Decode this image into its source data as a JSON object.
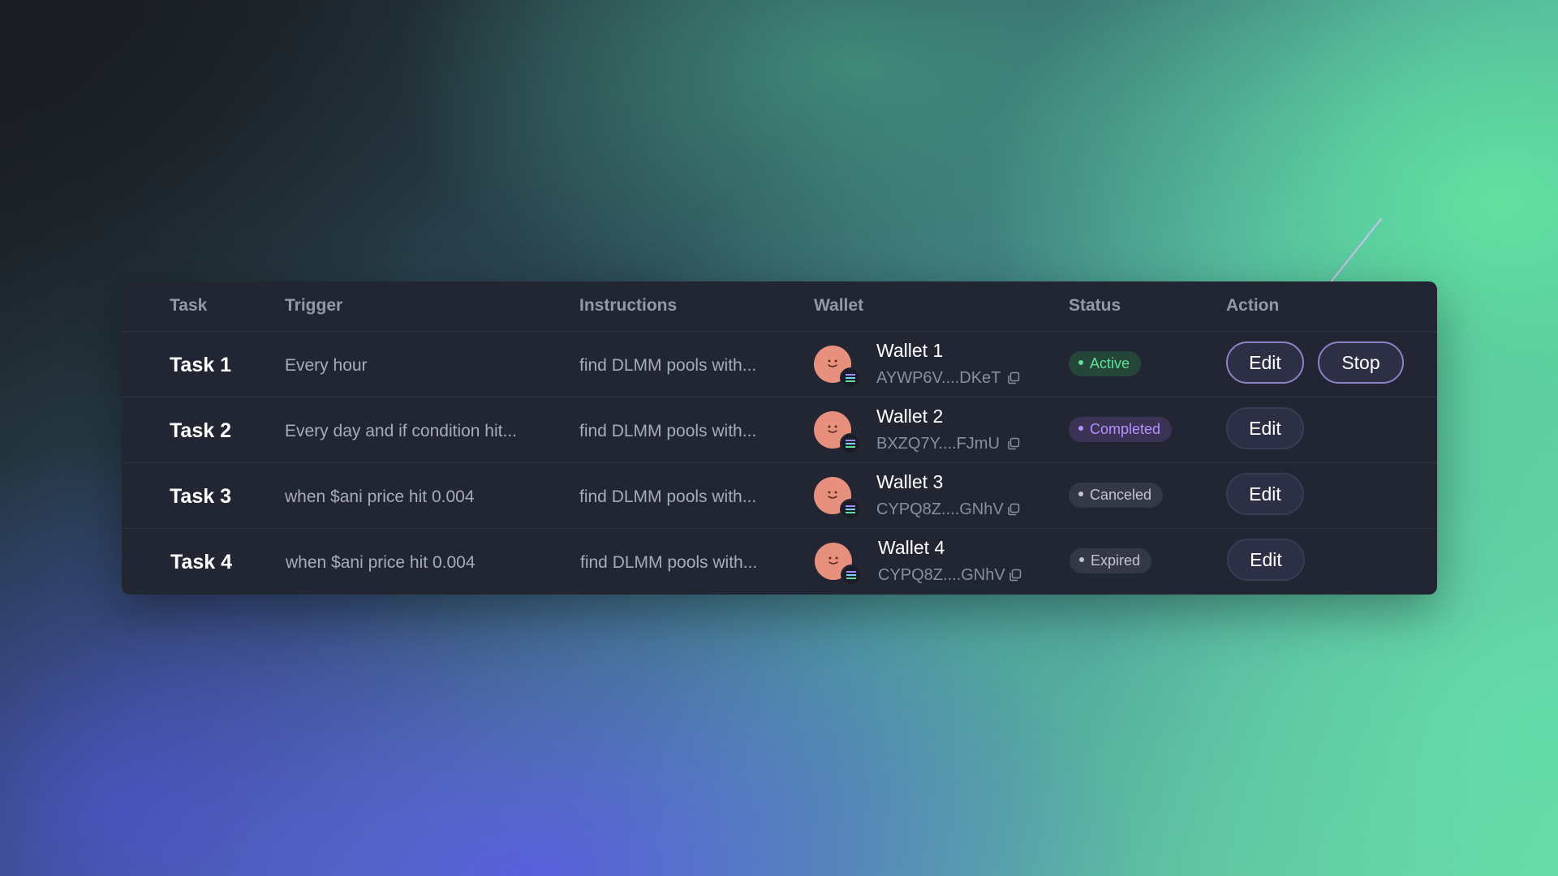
{
  "table": {
    "columns": {
      "task": "Task",
      "trigger": "Trigger",
      "instructions": "Instructions",
      "wallet": "Wallet",
      "status": "Status",
      "action": "Action"
    },
    "rows": [
      {
        "task": "Task 1",
        "trigger": "Every hour",
        "instructions": "find DLMM pools with...",
        "wallet_name": "Wallet 1",
        "wallet_address": "AYWP6V....DKeT",
        "status": "Active",
        "actions": [
          "Edit",
          "Stop"
        ]
      },
      {
        "task": "Task 2",
        "trigger": "Every day and if condition hit...",
        "instructions": "find DLMM pools with...",
        "wallet_name": "Wallet 2",
        "wallet_address": "BXZQ7Y....FJmU",
        "status": "Completed",
        "actions": [
          "Edit"
        ]
      },
      {
        "task": "Task 3",
        "trigger": "when $ani price hit 0.004",
        "instructions": "find DLMM pools with...",
        "wallet_name": "Wallet 3",
        "wallet_address": "CYPQ8Z....GNhV",
        "status": "Canceled",
        "actions": [
          "Edit"
        ]
      },
      {
        "task": "Task 4",
        "trigger": "when $ani price hit 0.004",
        "instructions": "find DLMM pools with...",
        "wallet_name": "Wallet 4",
        "wallet_address": "CYPQ8Z....GNhV",
        "status": "Expired",
        "actions": [
          "Edit"
        ]
      }
    ]
  },
  "icons": {
    "avatar": "smiley-face-avatar",
    "chain": "solana-icon",
    "copy": "copy-icon",
    "annotation": "arrow-pointer-icon"
  },
  "colors": {
    "active": "#5fe09a",
    "completed": "#b590ff",
    "canceled": "#c2c5cf",
    "expired": "#c2c5cf",
    "button_outline": "#8b82c8",
    "card_background": "#222633"
  }
}
